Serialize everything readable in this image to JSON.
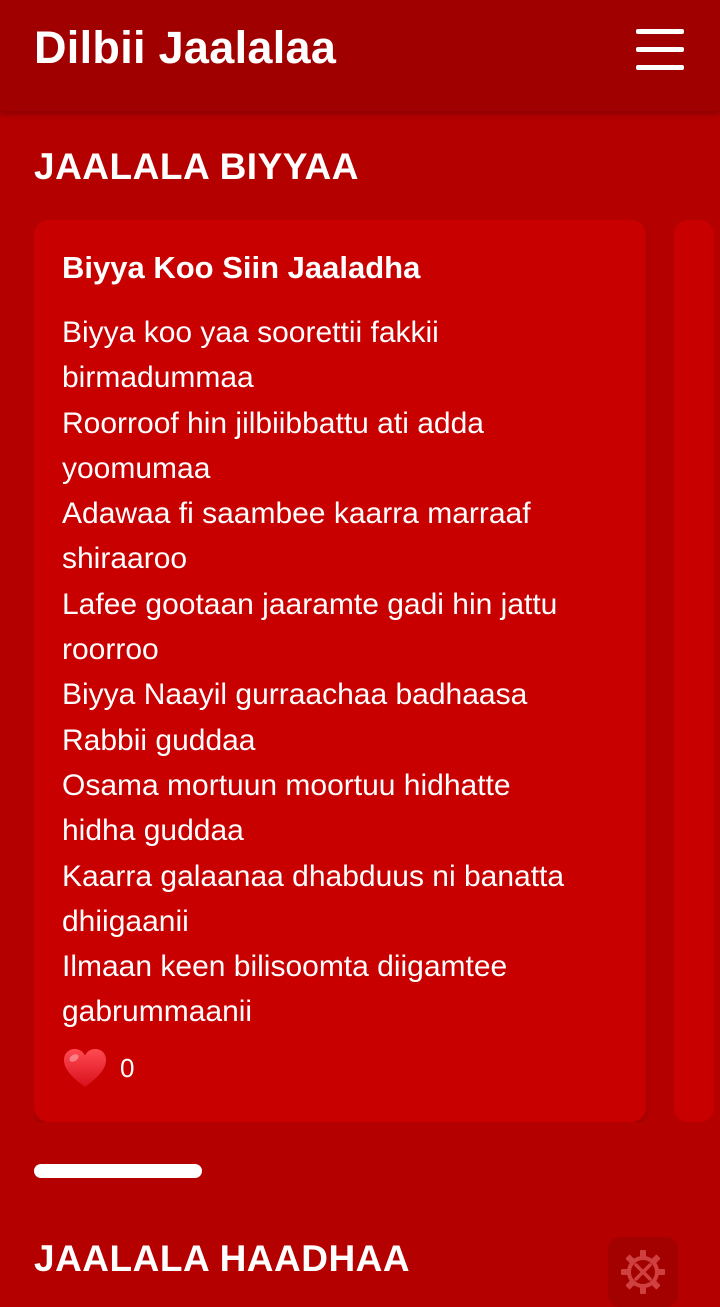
{
  "app": {
    "title": "Dilbii Jaalalaa"
  },
  "sections": [
    {
      "title": "JAALALA BIYYAA"
    },
    {
      "title": "JAALALA HAADHAA"
    }
  ],
  "poem": {
    "title": "Biyya Koo Siin Jaaladha",
    "lines": [
      "Biyya koo yaa soorettii fakkii\nbirmadummaa",
      "Roorroof hin jilbiibbattu ati adda\nyoomumaa",
      "Adawaa fi saambee kaarra marraaf\nshiraaroo",
      "Lafee gootaan jaaramte gadi hin jattu\nroorroo",
      "Biyya Naayil gurraachaa badhaasa\nRabbii guddaa",
      "Osama mortuun moortuu hidhatte\nhidha guddaa",
      "Kaarra galaanaa dhabduus ni banatta\ndhiigaanii",
      "Ilmaan keen bilisoomta diigamtee\ngabrummaanii"
    ],
    "likes": "0"
  },
  "icons": {
    "menu": "hamburger-menu-icon",
    "like": "heart-icon",
    "settings": "gear-wrench-icon"
  },
  "colors": {
    "background": "#b50000",
    "appbar": "#a00000",
    "card": "#c80000",
    "heart": "#e8202a"
  }
}
